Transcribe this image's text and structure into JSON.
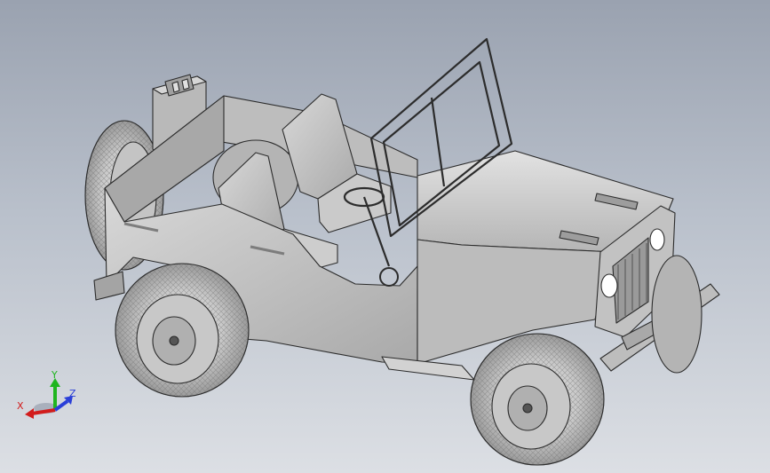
{
  "window": {
    "type": "cad-3d-viewport"
  },
  "model": {
    "icon": "jeep-3d-model"
  },
  "triad": {
    "x_label": "X",
    "y_label": "Y",
    "z_label": "Z",
    "colors": {
      "x": "#d21c1c",
      "y": "#1fb51f",
      "z": "#2a3fd8"
    }
  },
  "colors": {
    "background_top": "#9aa2b0",
    "background_bottom": "#dcdfe4",
    "body": "#c8c8c8",
    "body_dark": "#8e8e8e",
    "tire": "#b8b8b8",
    "edge": "#2c2c2c"
  }
}
